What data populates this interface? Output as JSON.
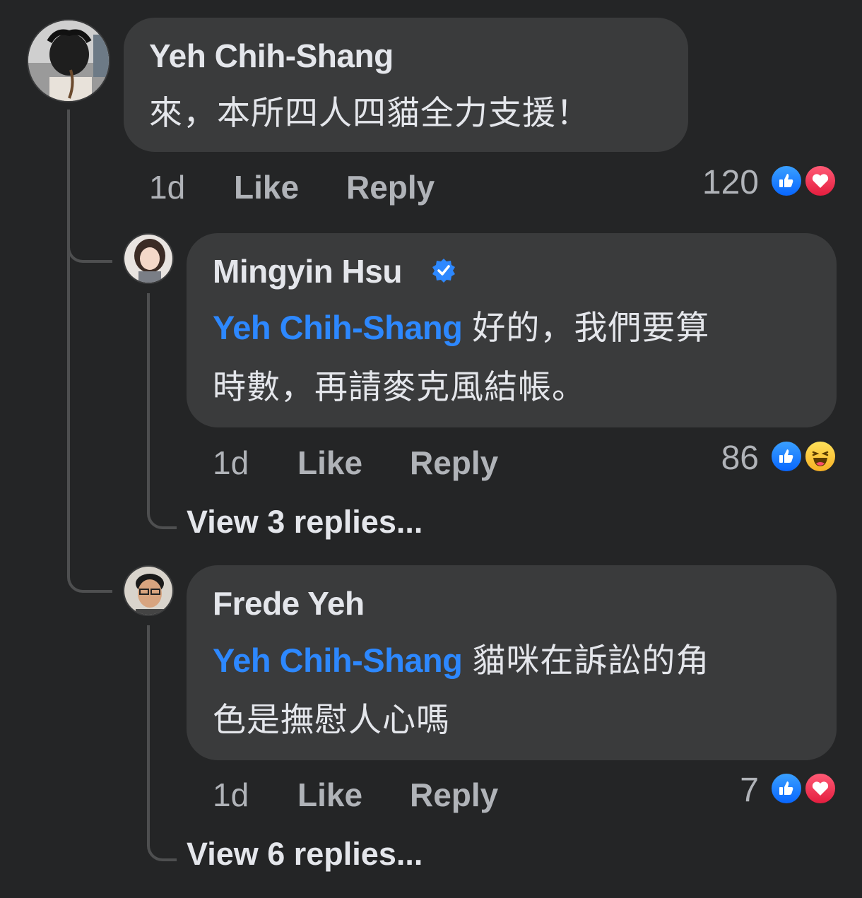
{
  "comments": [
    {
      "author": "Yeh Chih-Shang",
      "text": "來，本所四人四貓全力支援！",
      "time": "1d",
      "like_label": "Like",
      "reply_label": "Reply",
      "reaction_count": "120",
      "reactions": [
        "like-icon",
        "love-icon"
      ]
    }
  ],
  "replies": [
    {
      "author": "Mingyin Hsu",
      "verified": true,
      "mention": "Yeh Chih-Shang",
      "text_line1": "好的，我們要算",
      "text_line2": "時數，再請麥克風結帳。",
      "time": "1d",
      "like_label": "Like",
      "reply_label": "Reply",
      "reaction_count": "86",
      "reactions": [
        "like-icon",
        "haha-icon"
      ],
      "view_replies": "View 3 replies..."
    },
    {
      "author": "Frede Yeh",
      "verified": false,
      "mention": "Yeh Chih-Shang",
      "text_line1": "貓咪在訴訟的角",
      "text_line2": "色是撫慰人心嗎",
      "time": "1d",
      "like_label": "Like",
      "reply_label": "Reply",
      "reaction_count": "7",
      "reactions": [
        "like-icon",
        "love-icon"
      ],
      "view_replies": "View 6 replies..."
    }
  ],
  "colors": {
    "background": "#242526",
    "bubble": "#3a3b3c",
    "mention": "#2d88ff",
    "meta": "#b0b3b8",
    "like": "#0866ff",
    "love": "#e41e3f",
    "haha": "#f7b125"
  }
}
